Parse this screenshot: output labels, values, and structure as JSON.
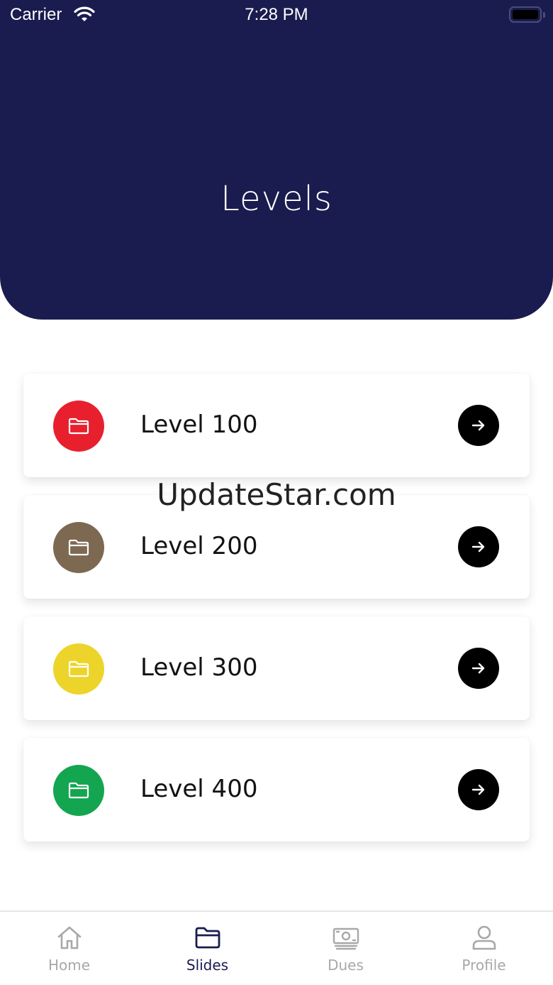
{
  "status_bar": {
    "carrier": "Carrier",
    "time": "7:28 PM"
  },
  "header": {
    "title": "Levels",
    "background": "#1a1c4f"
  },
  "levels": [
    {
      "label": "Level 100",
      "color": "#e8202e",
      "icon": "folder-icon"
    },
    {
      "label": "Level 200",
      "color": "#7d6852",
      "icon": "folder-icon"
    },
    {
      "label": "Level 300",
      "color": "#ecd42a",
      "icon": "folder-icon"
    },
    {
      "label": "Level 400",
      "color": "#14a550",
      "icon": "folder-icon"
    }
  ],
  "watermark": "UpdateStar.com",
  "tabbar": {
    "tabs": [
      {
        "label": "Home",
        "icon": "home-icon",
        "active": false
      },
      {
        "label": "Slides",
        "icon": "folder-icon",
        "active": true
      },
      {
        "label": "Dues",
        "icon": "cash-icon",
        "active": false
      },
      {
        "label": "Profile",
        "icon": "user-icon",
        "active": false
      }
    ],
    "active_color": "#1a1c4f",
    "inactive_color": "#a8a8a8"
  }
}
